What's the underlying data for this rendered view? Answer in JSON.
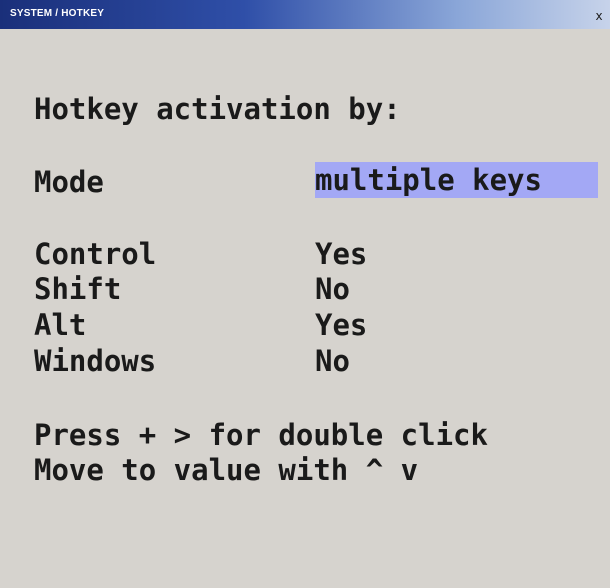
{
  "window": {
    "title": "SYSTEM / HOTKEY",
    "close_label": "x"
  },
  "main": {
    "heading": "Hotkey activation by:",
    "mode": {
      "label": "Mode",
      "value": "multiple keys"
    },
    "keys": [
      {
        "label": "Control",
        "value": "Yes"
      },
      {
        "label": "Shift",
        "value": "No"
      },
      {
        "label": "Alt",
        "value": "Yes"
      },
      {
        "label": "Windows",
        "value": "No"
      }
    ],
    "hints": [
      "Press + > for double click",
      "Move to value with ^ v"
    ]
  },
  "colors": {
    "background": "#d6d3ce",
    "highlight": "#a3a8f5",
    "titlebar_start": "#1a2f7a",
    "titlebar_end": "#c7d3ea",
    "text": "#1a1a1a"
  }
}
